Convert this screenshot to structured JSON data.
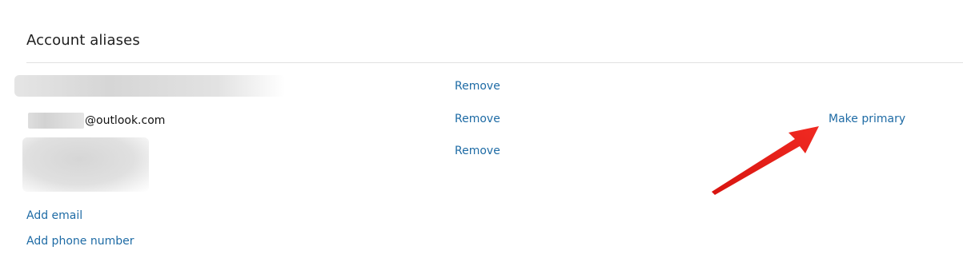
{
  "section": {
    "title": "Account aliases"
  },
  "aliases": [
    {
      "email": "",
      "action": "Remove"
    },
    {
      "email": "@outlook.com",
      "action": "Remove",
      "secondary_action": "Make primary"
    },
    {
      "email": "",
      "action": "Remove"
    }
  ],
  "actions": {
    "add_email": "Add email",
    "add_phone": "Add phone number"
  },
  "colors": {
    "link": "#1e6ba5",
    "arrow": "#e8231d",
    "divider": "#e1e1e1"
  }
}
